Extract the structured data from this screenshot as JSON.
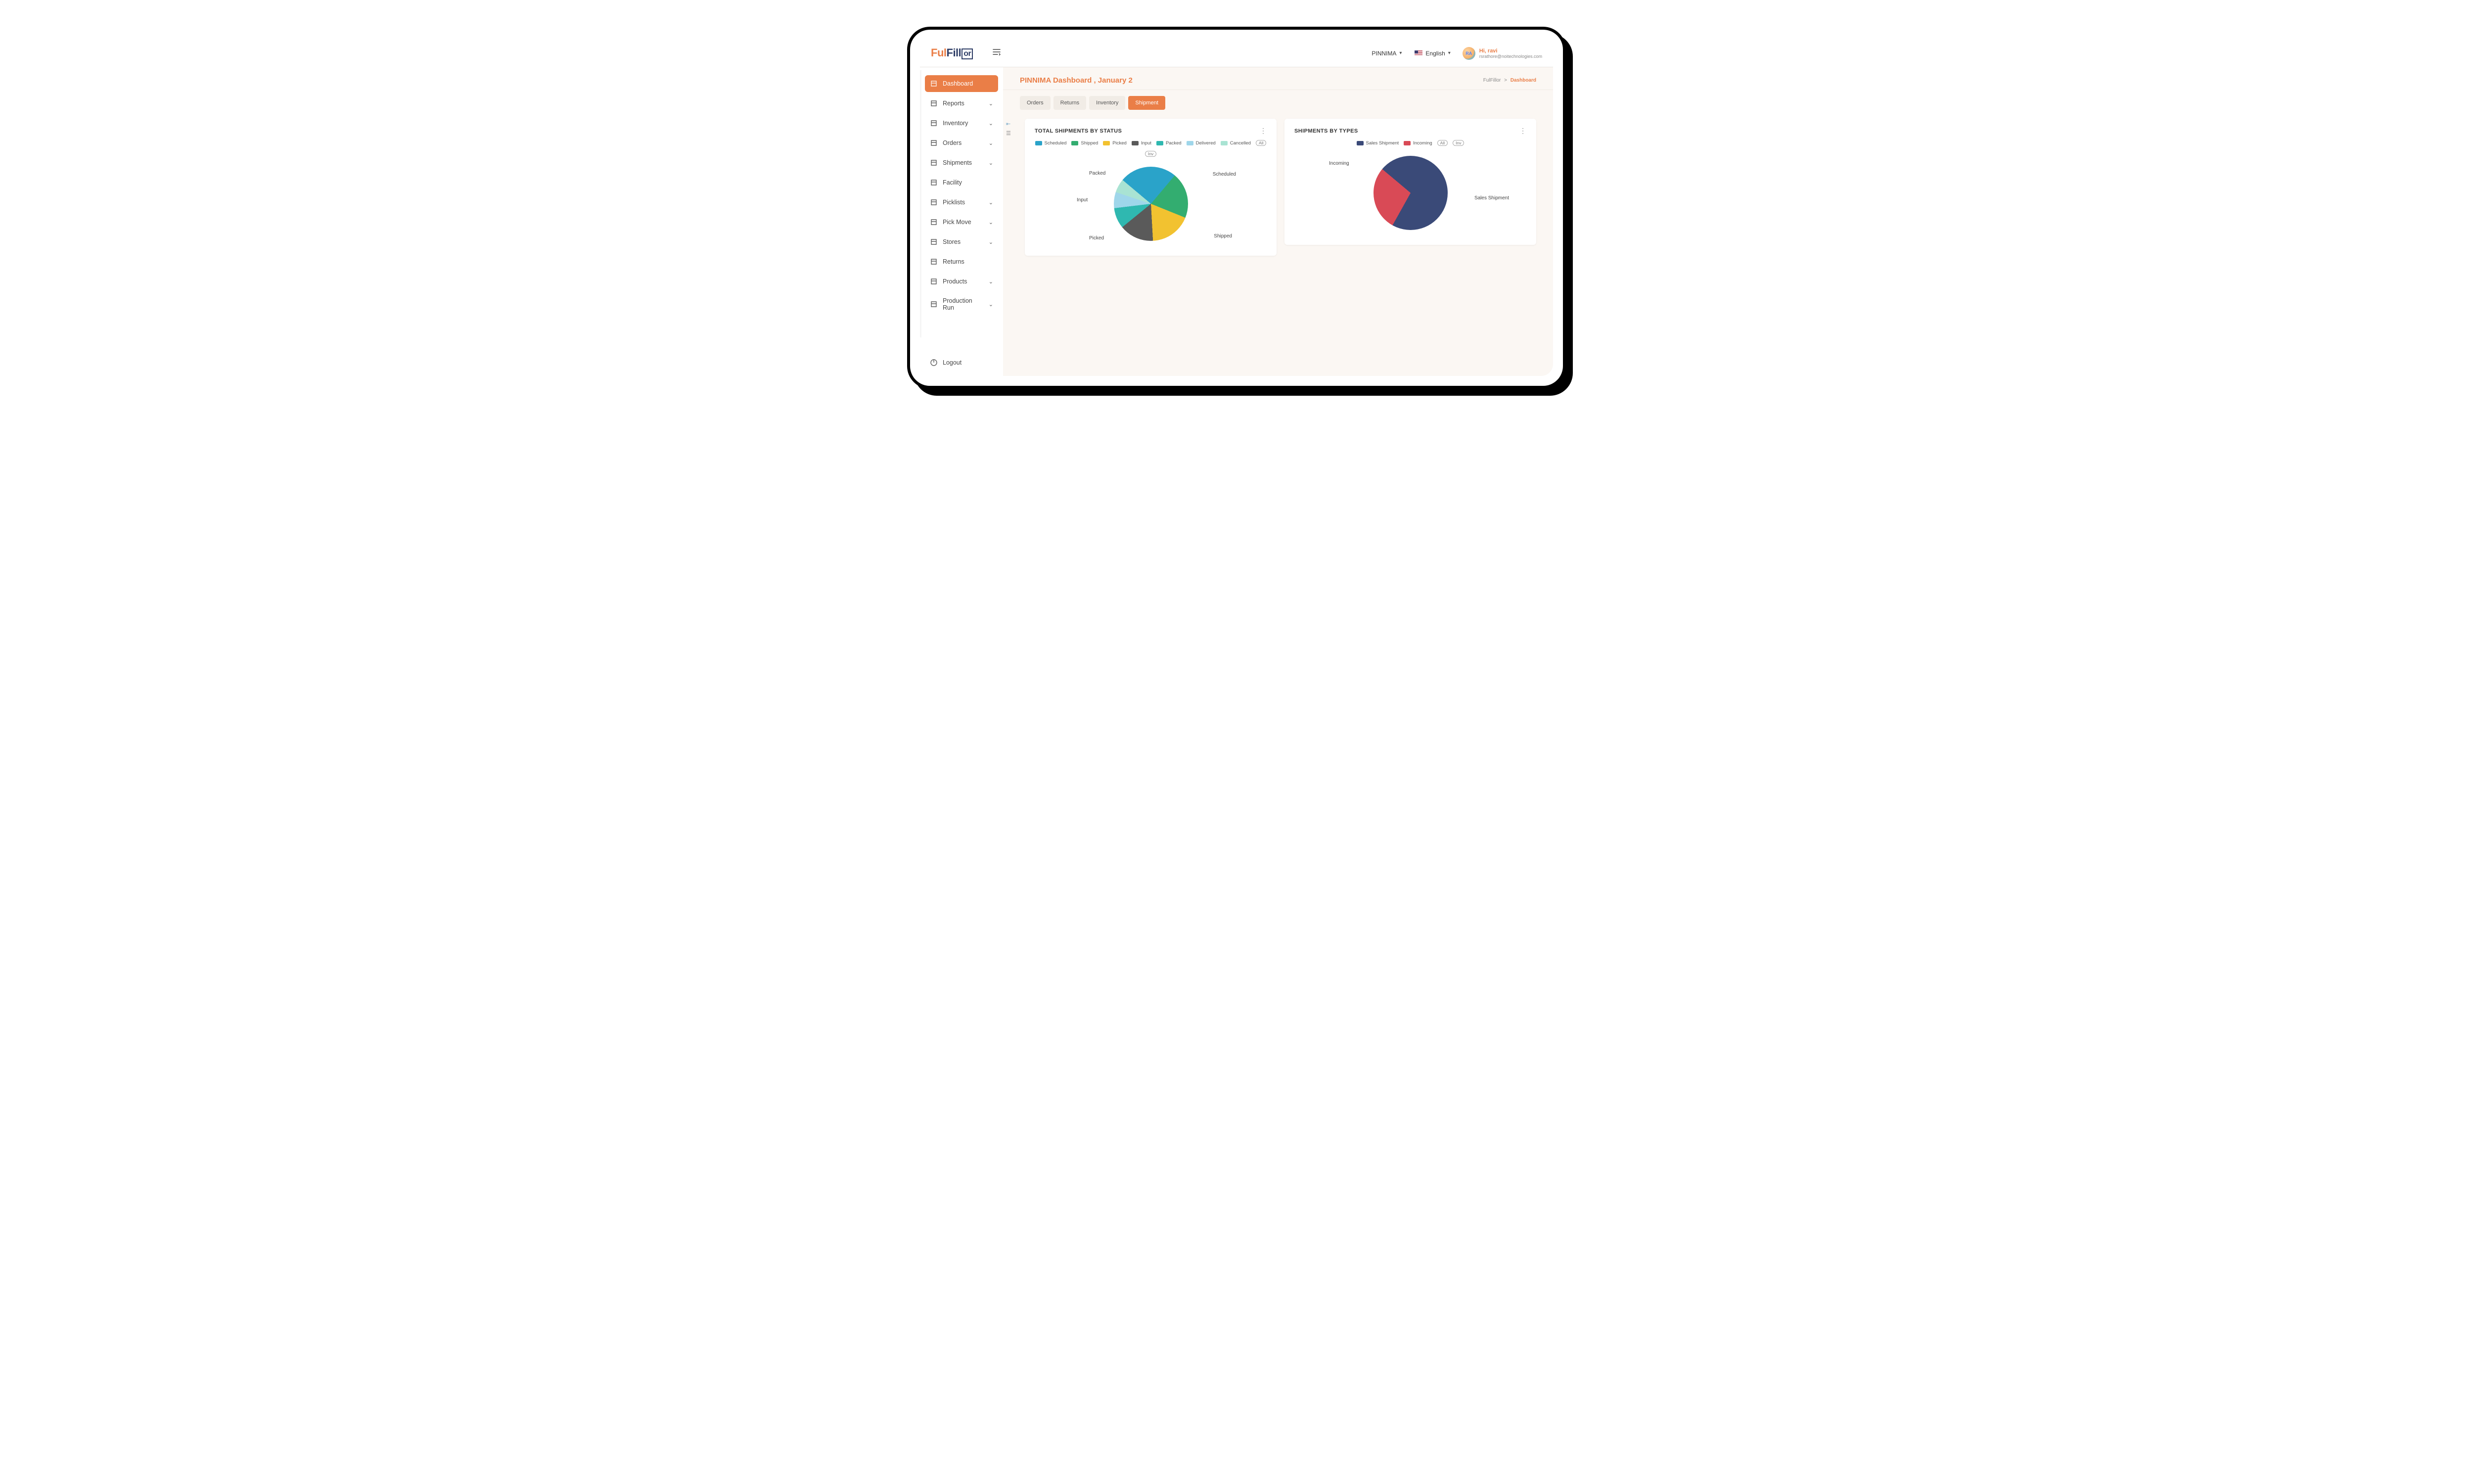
{
  "logo": {
    "part1": "Ful",
    "part2": "Fill",
    "part3": "or"
  },
  "header": {
    "org": "PINNIMA",
    "language": "English",
    "user_greeting": "Hi, ravi",
    "user_email": "rsrathore@noitechnologies.com",
    "avatar_initials": "RA"
  },
  "sidebar": {
    "items": [
      {
        "label": "Dashboard",
        "expandable": false,
        "active": true
      },
      {
        "label": "Reports",
        "expandable": true
      },
      {
        "label": "Inventory",
        "expandable": true
      },
      {
        "label": "Orders",
        "expandable": true
      },
      {
        "label": "Shipments",
        "expandable": true
      },
      {
        "label": "Facility",
        "expandable": false
      },
      {
        "label": "Picklists",
        "expandable": true
      },
      {
        "label": "Pick Move",
        "expandable": true
      },
      {
        "label": "Stores",
        "expandable": true
      },
      {
        "label": "Returns",
        "expandable": false
      },
      {
        "label": "Products",
        "expandable": true
      },
      {
        "label": "Production Run",
        "expandable": true
      }
    ],
    "logout": "Logout"
  },
  "page": {
    "title": "PINNIMA Dashboard , January 2",
    "breadcrumb_root": "FulFillor",
    "breadcrumb_sep": ">",
    "breadcrumb_current": "Dashboard"
  },
  "tabs": [
    {
      "label": "Orders",
      "active": false
    },
    {
      "label": "Returns",
      "active": false
    },
    {
      "label": "Inventory",
      "active": false
    },
    {
      "label": "Shipment",
      "active": true
    }
  ],
  "filters": {
    "all": "All",
    "inv": "Inv"
  },
  "cards": {
    "status": {
      "title": "TOTAL SHIPMENTS BY STATUS"
    },
    "types": {
      "title": "SHIPMENTS BY TYPES"
    }
  },
  "chart_data": [
    {
      "type": "pie",
      "title": "TOTAL SHIPMENTS BY STATUS",
      "series": [
        {
          "name": "Scheduled",
          "value": 25,
          "color": "#2aa3c9"
        },
        {
          "name": "Shipped",
          "value": 20,
          "color": "#33ad70"
        },
        {
          "name": "Picked",
          "value": 18,
          "color": "#f2c230"
        },
        {
          "name": "Input",
          "value": 15,
          "color": "#5a5a5a"
        },
        {
          "name": "Packed",
          "value": 9,
          "color": "#2fb8b0"
        },
        {
          "name": "Delivered",
          "value": 7,
          "color": "#9fd6ea"
        },
        {
          "name": "Cancelled",
          "value": 6,
          "color": "#a9e3d3"
        }
      ]
    },
    {
      "type": "pie",
      "title": "SHIPMENTS BY TYPES",
      "series": [
        {
          "name": "Sales Shipment",
          "value": 72,
          "color": "#3a4a78"
        },
        {
          "name": "Incoming",
          "value": 28,
          "color": "#d94a56"
        }
      ]
    }
  ]
}
